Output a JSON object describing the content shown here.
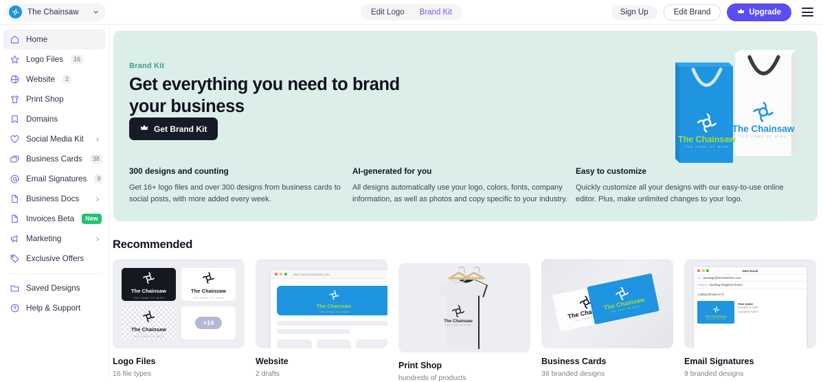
{
  "header": {
    "brand_name": "The Chainsaw",
    "brand_avatar_icon": "brand-avatar-logo",
    "chevron_icon": "chevron-down-icon",
    "toggle": {
      "edit_logo": "Edit Logo",
      "brand_kit": "Brand Kit"
    },
    "sign_up": "Sign Up",
    "edit_brand": "Edit Brand",
    "upgrade": "Upgrade",
    "upgrade_icon": "crown-icon",
    "menu_icon": "hamburger-icon"
  },
  "sidebar": {
    "items": [
      {
        "label": "Home",
        "icon": "home-icon",
        "badge": "",
        "caret": false,
        "active": true
      },
      {
        "label": "Logo Files",
        "icon": "star-icon",
        "badge": "16",
        "caret": false,
        "active": false
      },
      {
        "label": "Website",
        "icon": "globe-icon",
        "badge": "2",
        "caret": false,
        "active": false
      },
      {
        "label": "Print Shop",
        "icon": "tshirt-icon",
        "badge": "",
        "caret": false,
        "active": false
      },
      {
        "label": "Domains",
        "icon": "bookmark-icon",
        "badge": "",
        "caret": false,
        "active": false
      },
      {
        "label": "Social Media Kit",
        "icon": "heart-icon",
        "badge": "",
        "caret": true,
        "active": false
      },
      {
        "label": "Business Cards",
        "icon": "cards-icon",
        "badge": "38",
        "caret": false,
        "active": false
      },
      {
        "label": "Email Signatures",
        "icon": "at-icon",
        "badge": "9",
        "caret": false,
        "active": false
      },
      {
        "label": "Business Docs",
        "icon": "document-icon",
        "badge": "",
        "caret": true,
        "active": false
      },
      {
        "label": "Invoices Beta",
        "icon": "document-icon",
        "badge": "New",
        "badge_style": "new",
        "caret": false,
        "active": false
      },
      {
        "label": "Marketing",
        "icon": "megaphone-icon",
        "badge": "",
        "caret": true,
        "active": false
      },
      {
        "label": "Exclusive Offers",
        "icon": "tag-icon",
        "badge": "",
        "caret": false,
        "active": false
      }
    ],
    "footer_items": [
      {
        "label": "Saved Designs",
        "icon": "folder-icon"
      },
      {
        "label": "Help & Support",
        "icon": "help-circle-icon"
      }
    ]
  },
  "hero": {
    "eyebrow": "Brand Kit",
    "title": "Get everything you need to brand your business",
    "cta": "Get Brand Kit",
    "cta_icon": "crown-icon",
    "background_color": "#dceee9",
    "features": [
      {
        "title": "300 designs and counting",
        "body": "Get 16+ logo files and over 300 designs from business cards to social posts, with more added every week."
      },
      {
        "title": "AI-generated for you",
        "body": "All designs automatically use your logo, colors, fonts, company information, as well as photos and copy specific to your industry."
      },
      {
        "title": "Easy to customize",
        "body": "Quickly customize all your designs with our easy-to-use online editor. Plus, make unlimited changes to your logo."
      }
    ],
    "artwork": {
      "name": "shopping-bags-mockup",
      "bag_blue_color": "#1f94e0",
      "brand_text": "The Chainsaw",
      "brand_tagline": "THE HOME OF WIRE"
    }
  },
  "recommended": {
    "title": "Recommended",
    "cards": [
      {
        "name": "Logo Files",
        "sub": "16 file types",
        "thumb": "logo-files-grid",
        "tiles": [
          {
            "style": "dark",
            "name": "The Chainsaw",
            "tagline": "THE HOME OF WIRE"
          },
          {
            "style": "light",
            "name": "The Chainsaw",
            "tagline": "THE HOME OF WIRE"
          },
          {
            "style": "transparent",
            "name": "The Chainsaw",
            "tagline": "THE HOME OF WIRE"
          },
          {
            "style": "more",
            "more_label": "+14"
          }
        ]
      },
      {
        "name": "Website",
        "sub": "2 drafts",
        "thumb": "website-preview",
        "url": "http://yourcompany.com",
        "brand_text": "The Chainsaw",
        "brand_tagline": "THE HOME OF WIRE"
      },
      {
        "name": "Print Shop",
        "sub": "hundreds of products",
        "thumb": "tshirt-mockup",
        "brand_text": "The Chainsaw",
        "brand_tagline": "THE HOME OF WIRE"
      },
      {
        "name": "Business Cards",
        "sub": "38 branded designs",
        "thumb": "business-cards-mockup",
        "brand_text": "The Chainsaw",
        "brand_tagline": "THE HOME OF WIRE"
      },
      {
        "name": "Email Signatures",
        "sub": "9 branded designs",
        "thumb": "email-preview",
        "email": {
          "window_title": "New Email",
          "to_label": "To:",
          "to_value": "bookings@technistoform.com",
          "subject_label": "Subject:",
          "subject_value": "Booking (Irrigation Room)",
          "body": "Looking forward to it!",
          "sig_name": "Your name",
          "sig_role": "Founder & CEO",
          "sig_company": "Company name",
          "brand_text": "The Chainsaw",
          "brand_tagline": "THE HOME OF WIRE"
        }
      }
    ]
  },
  "colors": {
    "accent_purple": "#5b4ef0",
    "sidebar_icon": "#7b61e8",
    "badge_green": "#21c275",
    "brand_blue": "#1f94e0",
    "brand_green": "#9ede3c",
    "hero_bg": "#dceee9",
    "hero_eyebrow": "#3f9e84"
  }
}
